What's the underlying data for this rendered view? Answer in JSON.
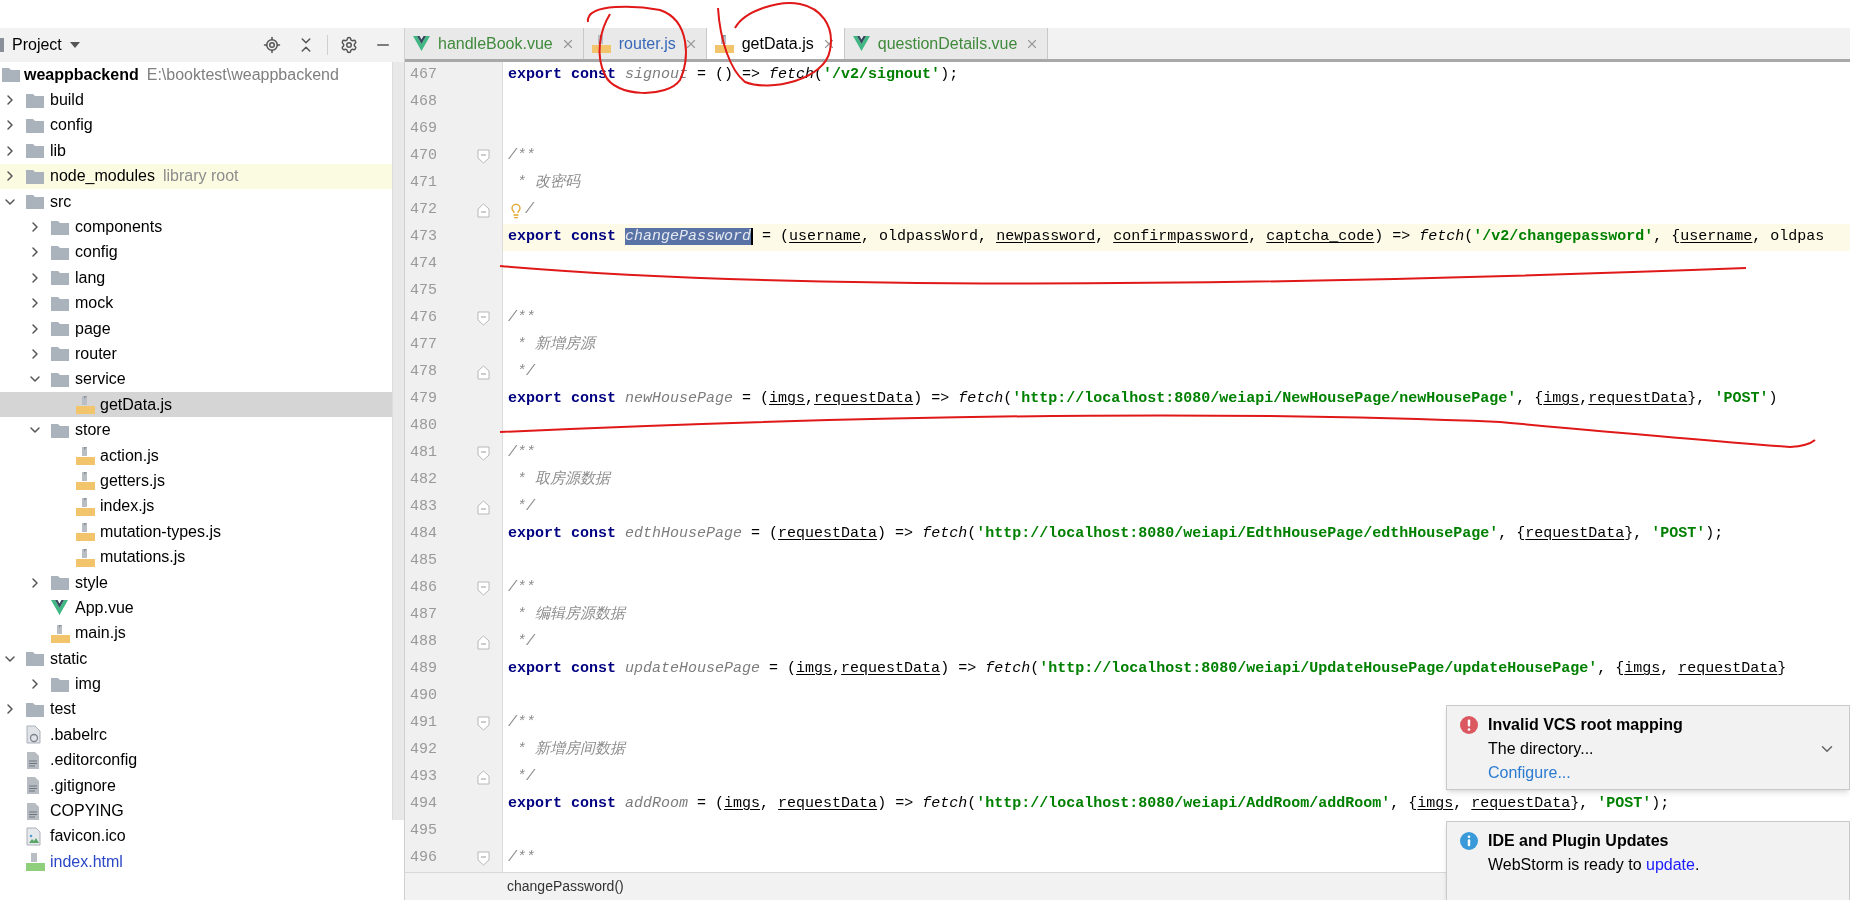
{
  "project_panel": {
    "title": "Project",
    "tree": {
      "name": "weappbackend",
      "path": "E:\\booktest\\weappbackend",
      "children": [
        {
          "name": "build",
          "kind": "folder",
          "expanded": false,
          "selected": false
        },
        {
          "name": "config",
          "kind": "folder",
          "expanded": false,
          "selected": false
        },
        {
          "name": "lib",
          "kind": "folder",
          "expanded": false,
          "selected": false
        },
        {
          "name": "node_modules",
          "kind": "library",
          "note": "library root",
          "expanded": false,
          "selected": false
        },
        {
          "name": "src",
          "kind": "folder",
          "expanded": true,
          "selected": false,
          "children": [
            {
              "name": "components",
              "kind": "folder",
              "expanded": false,
              "selected": false
            },
            {
              "name": "config",
              "kind": "folder",
              "expanded": false,
              "selected": false
            },
            {
              "name": "lang",
              "kind": "folder",
              "expanded": false,
              "selected": false
            },
            {
              "name": "mock",
              "kind": "folder",
              "expanded": false,
              "selected": false
            },
            {
              "name": "page",
              "kind": "folder",
              "expanded": false,
              "selected": false
            },
            {
              "name": "router",
              "kind": "folder",
              "expanded": false,
              "selected": false
            },
            {
              "name": "service",
              "kind": "folder",
              "expanded": true,
              "selected": false,
              "children": [
                {
                  "name": "getData.js",
                  "kind": "js",
                  "selected": true
                }
              ]
            },
            {
              "name": "store",
              "kind": "folder",
              "expanded": true,
              "selected": false,
              "children": [
                {
                  "name": "action.js",
                  "kind": "js",
                  "selected": false
                },
                {
                  "name": "getters.js",
                  "kind": "js",
                  "selected": false
                },
                {
                  "name": "index.js",
                  "kind": "js",
                  "selected": false
                },
                {
                  "name": "mutation-types.js",
                  "kind": "js",
                  "selected": false
                },
                {
                  "name": "mutations.js",
                  "kind": "js",
                  "selected": false
                }
              ]
            },
            {
              "name": "style",
              "kind": "folder",
              "expanded": false,
              "selected": false
            },
            {
              "name": "App.vue",
              "kind": "vue",
              "selected": false
            },
            {
              "name": "main.js",
              "kind": "js",
              "selected": false
            }
          ]
        },
        {
          "name": "static",
          "kind": "folder",
          "expanded": true,
          "selected": false,
          "children": [
            {
              "name": "img",
              "kind": "folder",
              "expanded": false,
              "selected": false
            }
          ]
        },
        {
          "name": "test",
          "kind": "folder",
          "expanded": false,
          "selected": false
        },
        {
          "name": ".babelrc",
          "kind": "config",
          "selected": false
        },
        {
          "name": ".editorconfig",
          "kind": "text",
          "selected": false
        },
        {
          "name": ".gitignore",
          "kind": "text",
          "selected": false
        },
        {
          "name": "COPYING",
          "kind": "text",
          "selected": false
        },
        {
          "name": "favicon.ico",
          "kind": "image",
          "selected": false
        },
        {
          "name": "index.html",
          "kind": "html",
          "selected": false,
          "color": "#2a47c6"
        }
      ]
    }
  },
  "tabs": [
    {
      "label": "handleBook.vue",
      "kind": "vue",
      "color": "#3f8a3c",
      "selected": false
    },
    {
      "label": "router.js",
      "kind": "js",
      "color": "#3868b8",
      "selected": false
    },
    {
      "label": "getData.js",
      "kind": "js",
      "color": "#000000",
      "selected": true
    },
    {
      "label": "questionDetails.vue",
      "kind": "vue",
      "color": "#3f8a3c",
      "selected": false
    }
  ],
  "code_lines": [
    {
      "number": "467",
      "tokens": [
        {
          "kind": "kw",
          "text": "export const "
        },
        {
          "kind": "decl",
          "text": "signout"
        },
        {
          "kind": "plain",
          "text": " = () => "
        },
        {
          "kind": "fn",
          "text": "fetch"
        },
        {
          "kind": "plain",
          "text": "("
        },
        {
          "kind": "str",
          "text": "'/v2/signout'"
        },
        {
          "kind": "plain",
          "text": ");"
        }
      ]
    },
    {
      "number": "468"
    },
    {
      "number": "469"
    },
    {
      "number": "470",
      "fold_open": true,
      "tokens": [
        {
          "kind": "comment",
          "text": "/**"
        }
      ]
    },
    {
      "number": "471",
      "tokens": [
        {
          "kind": "comment",
          "text": " * 改密码"
        }
      ]
    },
    {
      "number": "472",
      "fold_close": true,
      "hint": true,
      "tokens": [
        {
          "kind": "comment",
          "text": "/"
        }
      ]
    },
    {
      "number": "473",
      "current": true,
      "tokens": [
        {
          "kind": "kw",
          "text": "export const "
        },
        {
          "kind": "selection",
          "text": "changePassword"
        },
        {
          "kind": "plain",
          "text": " = ("
        },
        {
          "kind": "param",
          "text": "username"
        },
        {
          "kind": "plain",
          "text": ", oldpassWord, "
        },
        {
          "kind": "param",
          "text": "newpassword"
        },
        {
          "kind": "plain",
          "text": ", "
        },
        {
          "kind": "param",
          "text": "confirmpassword"
        },
        {
          "kind": "plain",
          "text": ", "
        },
        {
          "kind": "param",
          "text": "captcha_code"
        },
        {
          "kind": "plain",
          "text": ") => "
        },
        {
          "kind": "fn",
          "text": "fetch"
        },
        {
          "kind": "plain",
          "text": "("
        },
        {
          "kind": "str",
          "text": "'/v2/changepassword'"
        },
        {
          "kind": "plain",
          "text": ", {"
        },
        {
          "kind": "param",
          "text": "username"
        },
        {
          "kind": "plain",
          "text": ", oldpas"
        }
      ]
    },
    {
      "number": "474"
    },
    {
      "number": "475"
    },
    {
      "number": "476",
      "fold_open": true,
      "tokens": [
        {
          "kind": "comment",
          "text": "/**"
        }
      ]
    },
    {
      "number": "477",
      "tokens": [
        {
          "kind": "comment",
          "text": " * 新增房源"
        }
      ]
    },
    {
      "number": "478",
      "fold_close": true,
      "tokens": [
        {
          "kind": "comment",
          "text": " */"
        }
      ]
    },
    {
      "number": "479",
      "tokens": [
        {
          "kind": "kw",
          "text": "export const "
        },
        {
          "kind": "decl",
          "text": "newHousePage"
        },
        {
          "kind": "plain",
          "text": " = ("
        },
        {
          "kind": "param",
          "text": "imgs"
        },
        {
          "kind": "plain",
          "text": ","
        },
        {
          "kind": "param",
          "text": "requestData"
        },
        {
          "kind": "plain",
          "text": ") => "
        },
        {
          "kind": "fn",
          "text": "fetch"
        },
        {
          "kind": "plain",
          "text": "("
        },
        {
          "kind": "str",
          "text": "'http://localhost:8080/weiapi/NewHousePage/newHousePage'"
        },
        {
          "kind": "plain",
          "text": ", {"
        },
        {
          "kind": "param",
          "text": "imgs"
        },
        {
          "kind": "plain",
          "text": ","
        },
        {
          "kind": "param",
          "text": "requestData"
        },
        {
          "kind": "plain",
          "text": "}, "
        },
        {
          "kind": "str",
          "text": "'POST'"
        },
        {
          "kind": "plain",
          "text": ")"
        }
      ]
    },
    {
      "number": "480"
    },
    {
      "number": "481",
      "fold_open": true,
      "tokens": [
        {
          "kind": "comment",
          "text": "/**"
        }
      ]
    },
    {
      "number": "482",
      "tokens": [
        {
          "kind": "comment",
          "text": " * 取房源数据"
        }
      ]
    },
    {
      "number": "483",
      "fold_close": true,
      "tokens": [
        {
          "kind": "comment",
          "text": " */"
        }
      ]
    },
    {
      "number": "484",
      "tokens": [
        {
          "kind": "kw",
          "text": "export const "
        },
        {
          "kind": "decl",
          "text": "edthHousePage"
        },
        {
          "kind": "plain",
          "text": " = ("
        },
        {
          "kind": "param",
          "text": "requestData"
        },
        {
          "kind": "plain",
          "text": ") => "
        },
        {
          "kind": "fn",
          "text": "fetch"
        },
        {
          "kind": "plain",
          "text": "("
        },
        {
          "kind": "str",
          "text": "'http://localhost:8080/weiapi/EdthHousePage/edthHousePage'"
        },
        {
          "kind": "plain",
          "text": ", {"
        },
        {
          "kind": "param",
          "text": "requestData"
        },
        {
          "kind": "plain",
          "text": "}, "
        },
        {
          "kind": "str",
          "text": "'POST'"
        },
        {
          "kind": "plain",
          "text": ");"
        }
      ]
    },
    {
      "number": "485"
    },
    {
      "number": "486",
      "fold_open": true,
      "tokens": [
        {
          "kind": "comment",
          "text": "/**"
        }
      ]
    },
    {
      "number": "487",
      "tokens": [
        {
          "kind": "comment",
          "text": " * 编辑房源数据"
        }
      ]
    },
    {
      "number": "488",
      "fold_close": true,
      "tokens": [
        {
          "kind": "comment",
          "text": " */"
        }
      ]
    },
    {
      "number": "489",
      "tokens": [
        {
          "kind": "kw",
          "text": "export const "
        },
        {
          "kind": "decl",
          "text": "updateHousePage"
        },
        {
          "kind": "plain",
          "text": " = ("
        },
        {
          "kind": "param",
          "text": "imgs"
        },
        {
          "kind": "plain",
          "text": ","
        },
        {
          "kind": "param",
          "text": "requestData"
        },
        {
          "kind": "plain",
          "text": ") => "
        },
        {
          "kind": "fn",
          "text": "fetch"
        },
        {
          "kind": "plain",
          "text": "("
        },
        {
          "kind": "str",
          "text": "'http://localhost:8080/weiapi/UpdateHousePage/updateHousePage'"
        },
        {
          "kind": "plain",
          "text": ", {"
        },
        {
          "kind": "param",
          "text": "imgs"
        },
        {
          "kind": "plain",
          "text": ", "
        },
        {
          "kind": "param",
          "text": "requestData"
        },
        {
          "kind": "plain",
          "text": "}"
        }
      ]
    },
    {
      "number": "490"
    },
    {
      "number": "491",
      "fold_open": true,
      "tokens": [
        {
          "kind": "comment",
          "text": "/**"
        }
      ]
    },
    {
      "number": "492",
      "tokens": [
        {
          "kind": "comment",
          "text": " * 新增房间数据"
        }
      ]
    },
    {
      "number": "493",
      "fold_close": true,
      "tokens": [
        {
          "kind": "comment",
          "text": " */"
        }
      ]
    },
    {
      "number": "494",
      "tokens": [
        {
          "kind": "kw",
          "text": "export const "
        },
        {
          "kind": "decl",
          "text": "addRoom"
        },
        {
          "kind": "plain",
          "text": " = ("
        },
        {
          "kind": "param",
          "text": "imgs"
        },
        {
          "kind": "plain",
          "text": ", "
        },
        {
          "kind": "param",
          "text": "requestData"
        },
        {
          "kind": "plain",
          "text": ") => "
        },
        {
          "kind": "fn",
          "text": "fetch"
        },
        {
          "kind": "plain",
          "text": "("
        },
        {
          "kind": "str",
          "text": "'http://localhost:8080/weiapi/AddRoom/addRoom'"
        },
        {
          "kind": "plain",
          "text": ", {"
        },
        {
          "kind": "param",
          "text": "imgs"
        },
        {
          "kind": "plain",
          "text": ", "
        },
        {
          "kind": "param",
          "text": "requestData"
        },
        {
          "kind": "plain",
          "text": "}, "
        },
        {
          "kind": "str",
          "text": "'POST'"
        },
        {
          "kind": "plain",
          "text": ");"
        }
      ]
    },
    {
      "number": "495"
    },
    {
      "number": "496",
      "fold_open": true,
      "tokens": [
        {
          "kind": "comment",
          "text": "/**"
        }
      ]
    }
  ],
  "breadcrumb": "changePassword()",
  "notifications": [
    {
      "kind": "error",
      "title": "Invalid VCS root mapping",
      "body": "The directory...",
      "action": "Configure...",
      "expandable": true
    },
    {
      "kind": "info",
      "title": "IDE and Plugin Updates",
      "body": "WebStorm is ready to ",
      "link": "update",
      "body_end": ".",
      "expandable": false
    }
  ]
}
